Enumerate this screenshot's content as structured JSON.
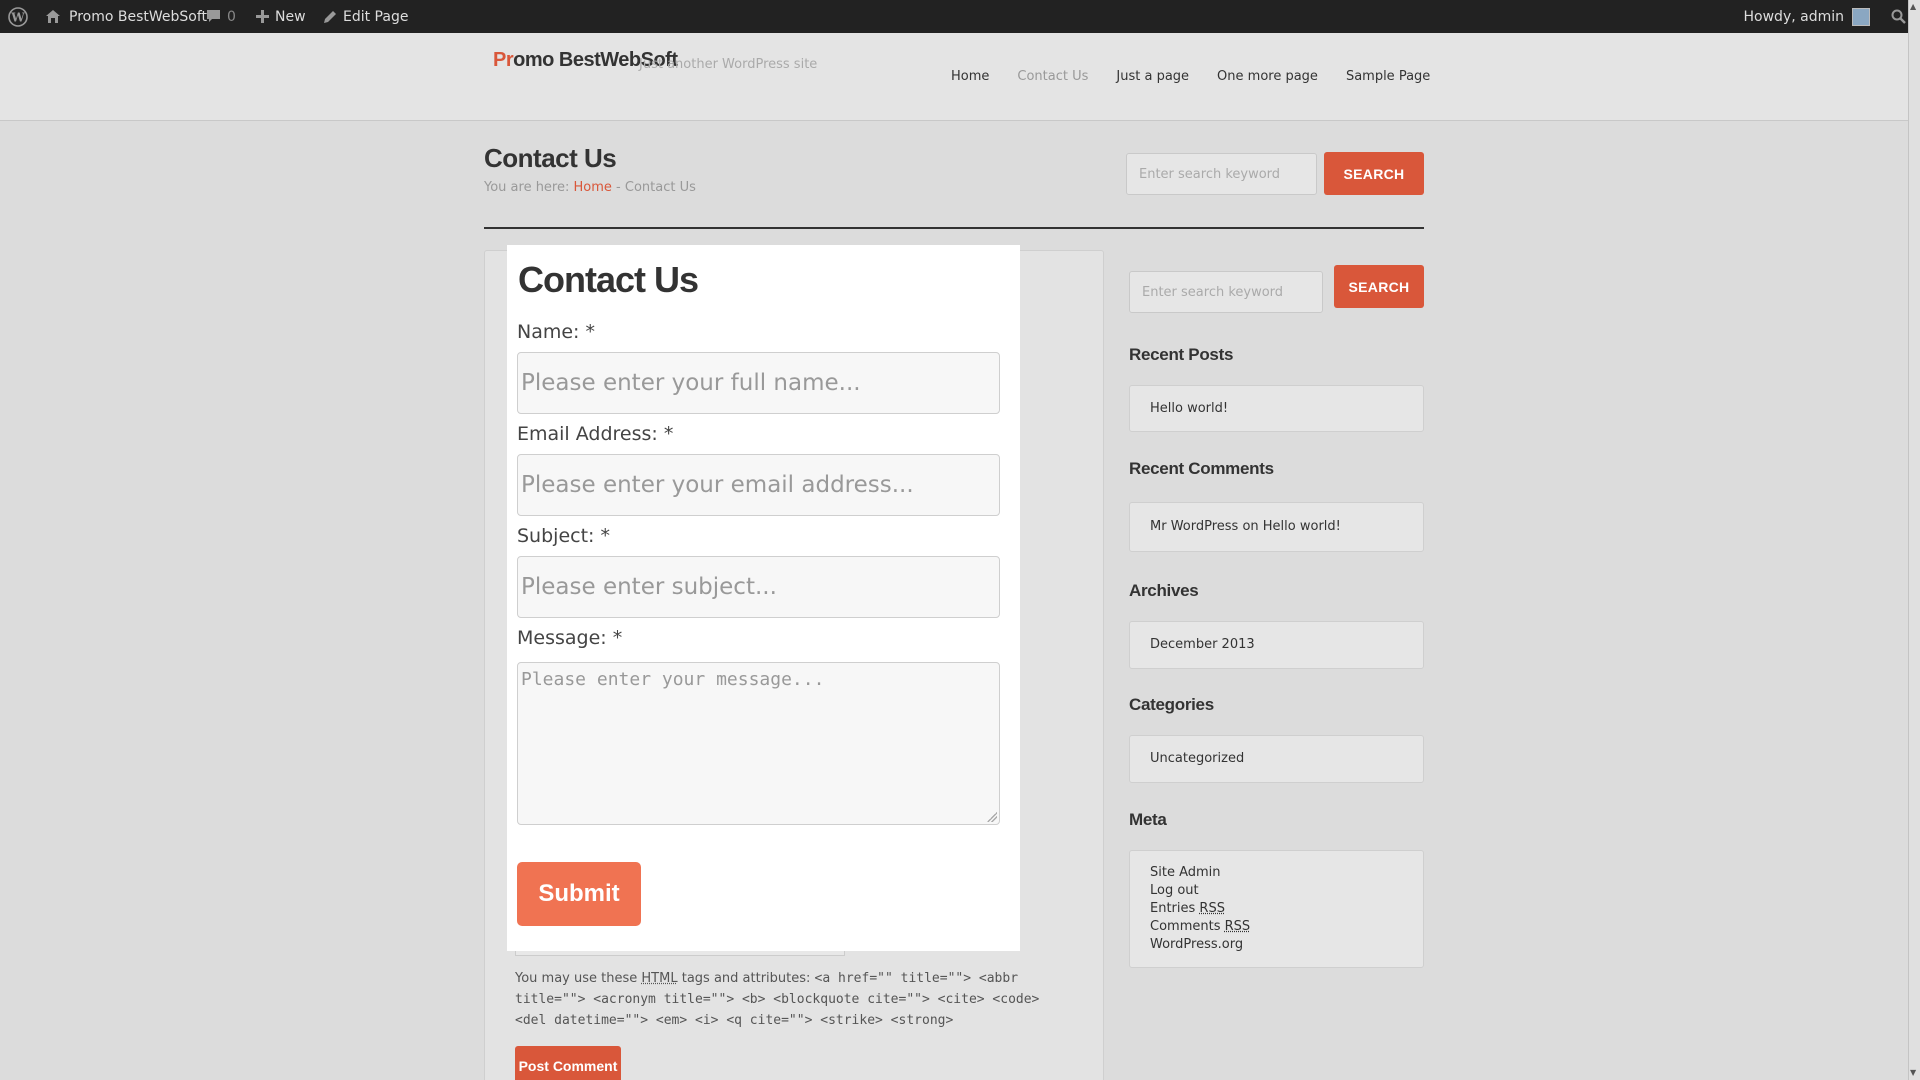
{
  "adminbar": {
    "site_name": "Promo BestWebSoft",
    "comments_count": "0",
    "new_label": "New",
    "edit_label": "Edit Page",
    "howdy": "Howdy, admin"
  },
  "header": {
    "logo_accent": "Pr",
    "logo_rest": "omo BestWebSoft",
    "tagline": "Just another WordPress site",
    "nav": [
      {
        "label": "Home"
      },
      {
        "label": "Contact Us"
      },
      {
        "label": "Just a page"
      },
      {
        "label": "One more page"
      },
      {
        "label": "Sample Page"
      }
    ]
  },
  "page": {
    "title": "Contact Us",
    "breadcrumb_prefix": "You are here:",
    "breadcrumb_home": "Home",
    "breadcrumb_sep": "-",
    "breadcrumb_current": "Contact Us",
    "search_placeholder": "Enter search keyword",
    "search_button": "SEARCH"
  },
  "content": {
    "html_note_prefix": "You may use these",
    "html_abbr": "HTML",
    "html_note_mid": "tags and attributes:",
    "html_tags": "<a href=\"\" title=\"\"> <abbr title=\"\"> <acronym title=\"\"> <b> <blockquote cite=\"\"> <cite> <code> <del datetime=\"\"> <em> <i> <q cite=\"\"> <strike> <strong>",
    "post_comment": "Post Comment"
  },
  "sidebar": {
    "search_placeholder": "Enter search keyword",
    "search_button": "SEARCH",
    "recent_posts_title": "Recent Posts",
    "recent_posts": [
      "Hello world!"
    ],
    "recent_comments_title": "Recent Comments",
    "recent_comment": "Mr WordPress on Hello world!",
    "archives_title": "Archives",
    "archives": [
      "December 2013"
    ],
    "categories_title": "Categories",
    "categories": [
      "Uncategorized"
    ],
    "meta_title": "Meta",
    "meta": {
      "site_admin": "Site Admin",
      "log_out": "Log out",
      "entries": "Entries",
      "comments": "Comments",
      "rss": "RSS",
      "wordpress_org": "WordPress.org"
    }
  },
  "modal": {
    "title": "Contact Us",
    "name_label": "Name: *",
    "name_placeholder": "Please enter your full name...",
    "email_label": "Email Address: *",
    "email_placeholder": "Please enter your email address...",
    "subject_label": "Subject: *",
    "subject_placeholder": "Please enter subject...",
    "message_label": "Message: *",
    "message_placeholder": "Please enter your message...",
    "submit": "Submit"
  },
  "colors": {
    "accent": "#d9573a",
    "submit": "#f07352",
    "adminbar": "#222222"
  }
}
